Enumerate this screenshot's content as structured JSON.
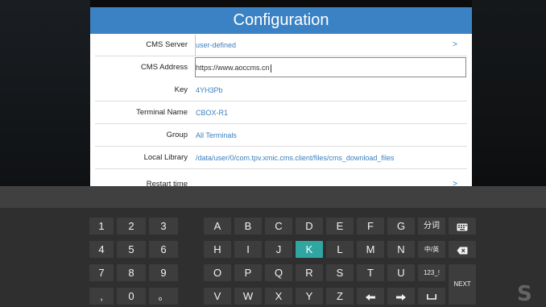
{
  "config": {
    "title": "Configuration",
    "rows": [
      {
        "label": "CMS Server",
        "value": "user-defined"
      },
      {
        "label": "CMS Address",
        "value": "https://www.aoccms.cn"
      },
      {
        "label": "Key",
        "value": "4YH3Pb"
      },
      {
        "label": "Terminal Name",
        "value": "CBOX-R1"
      },
      {
        "label": "Group",
        "value": "All Terminals"
      },
      {
        "label": "Local Library",
        "value": "/data/user/0/com.tpv.xmic.cms.client/files/cms_download_files"
      },
      {
        "label": "Restart time",
        "value": ""
      }
    ],
    "chevron": ">"
  },
  "keyboard": {
    "num_rows": [
      [
        "1",
        "2",
        "3"
      ],
      [
        "4",
        "5",
        "6"
      ],
      [
        "7",
        "8",
        "9"
      ],
      [
        ",",
        "0",
        "。"
      ]
    ],
    "alpha_rows": [
      [
        "A",
        "B",
        "C",
        "D",
        "E",
        "F",
        "G"
      ],
      [
        "H",
        "I",
        "J",
        "K",
        "L",
        "M",
        "N"
      ],
      [
        "O",
        "P",
        "Q",
        "R",
        "S",
        "T",
        "U"
      ],
      [
        "V",
        "W",
        "X",
        "Y",
        "Z"
      ]
    ],
    "active_key": "K",
    "func": {
      "word_segment": "分词",
      "lang_toggle": "中/英",
      "symbols": "123_!",
      "next": "NEXT"
    },
    "accent": "#2fa6a2"
  }
}
